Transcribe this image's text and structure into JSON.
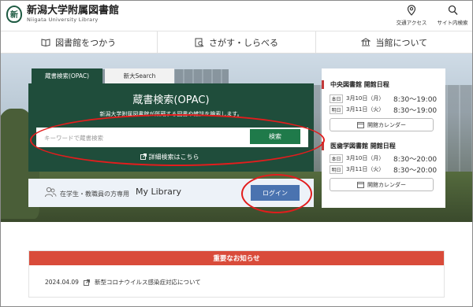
{
  "header": {
    "logo_mark": "新",
    "title": "新潟大学附属図書館",
    "subtitle": "Niigata University Library",
    "access_label": "交通アクセス",
    "search_label": "サイト内検索"
  },
  "nav": {
    "items": [
      {
        "label": "図書館をつかう",
        "icon": "book-icon"
      },
      {
        "label": "さがす・しらべる",
        "icon": "document-search-icon"
      },
      {
        "label": "当館について",
        "icon": "building-icon"
      }
    ]
  },
  "search": {
    "tabs": [
      {
        "label": "蔵書検索(OPAC)",
        "active": true
      },
      {
        "label": "新大Search",
        "active": false
      }
    ],
    "title": "蔵書検索(OPAC)",
    "description": "新潟大学附属図書館が所蔵する図書や雑誌を検索します。",
    "placeholder": "キーワードで蔵書検索",
    "button_label": "検索",
    "advanced_link": "詳細検索はこちら"
  },
  "mylibrary": {
    "note": "在学生・教職員の方専用",
    "title": "My Library",
    "login_label": "ログイン"
  },
  "schedule": {
    "libraries": [
      {
        "name": "中央図書館 開館日程",
        "rows": [
          {
            "label": "本日",
            "date": "3月10日（月）",
            "time": "8:30～19:00"
          },
          {
            "label": "明日",
            "date": "3月11日（火）",
            "time": "8:30～19:00"
          }
        ],
        "calendar_label": "開館カレンダー"
      },
      {
        "name": "医歯学図書館 開館日程",
        "rows": [
          {
            "label": "本日",
            "date": "3月10日（月）",
            "time": "8:30～20:00"
          },
          {
            "label": "明日",
            "date": "3月11日（火）",
            "time": "8:30～20:00"
          }
        ],
        "calendar_label": "開館カレンダー"
      }
    ]
  },
  "notice": {
    "heading": "重要なお知らせ",
    "items": [
      {
        "date": "2024.04.09",
        "text": "新型コロナウイルス感染症対応について"
      }
    ]
  },
  "colors": {
    "brand_green": "#1f4d3b",
    "search_button": "#1f7a4a",
    "login_button": "#4a73b0",
    "notice_red": "#d94b3a",
    "annotation_red": "#e21d1d"
  }
}
